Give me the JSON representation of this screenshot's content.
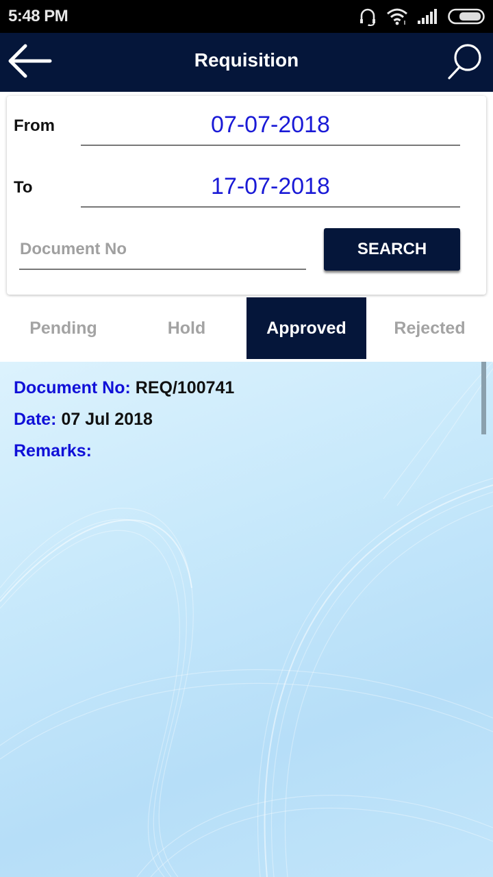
{
  "status_bar": {
    "time": "5:48 PM",
    "icons": [
      "headphones-icon",
      "wifi-icon",
      "signal-icon",
      "battery-icon"
    ]
  },
  "app_bar": {
    "title": "Requisition",
    "back_icon": "arrow-left-icon",
    "search_icon": "search-icon"
  },
  "filter": {
    "from_label": "From",
    "from_value": "07-07-2018",
    "to_label": "To",
    "to_value": "17-07-2018",
    "document_no_placeholder": "Document No",
    "document_no_value": "",
    "search_button": "SEARCH"
  },
  "tabs": [
    {
      "label": "Pending",
      "active": false
    },
    {
      "label": "Hold",
      "active": false
    },
    {
      "label": "Approved",
      "active": true
    },
    {
      "label": "Rejected",
      "active": false
    }
  ],
  "records": [
    {
      "document_no_label": "Document No:",
      "document_no": "REQ/100741",
      "date_label": "Date:",
      "date": "07 Jul 2018",
      "remarks_label": "Remarks:",
      "remarks": ""
    }
  ],
  "colors": {
    "primary": "#05163a",
    "value_blue": "#1a1ad6",
    "label_blue": "#1010d8",
    "inactive_tab": "#a3a3a3"
  }
}
